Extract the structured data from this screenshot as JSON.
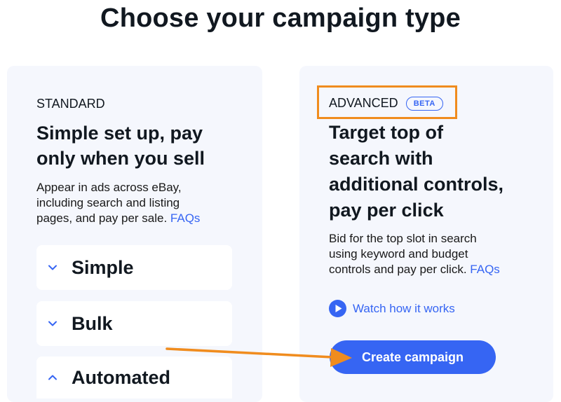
{
  "page": {
    "title": "Choose your campaign type"
  },
  "standard": {
    "kicker": "STANDARD",
    "heading_line1": "Simple set up, pay",
    "heading_line2": "only when you sell",
    "desc_line1": "Appear in ads across eBay,",
    "desc_line2": "including search and listing",
    "desc_line3": "pages, and pay per sale.",
    "faq_link": "FAQs",
    "options": [
      {
        "label": "Simple",
        "state": "collapsed",
        "icon": "chevron-down-icon"
      },
      {
        "label": "Bulk",
        "state": "collapsed",
        "icon": "chevron-down-icon"
      },
      {
        "label": "Automated",
        "state": "expanded",
        "icon": "chevron-up-icon"
      }
    ]
  },
  "advanced": {
    "kicker": "ADVANCED",
    "badge": "BETA",
    "heading_line1": "Target top of",
    "heading_line2": "search with",
    "heading_line3": "additional controls,",
    "heading_line4": "pay per click",
    "desc_line1": "Bid for the top slot in search",
    "desc_line2": "using keyword and budget",
    "desc_line3": "controls and pay per click.",
    "faq_link": "FAQs",
    "watch_link": "Watch how it works",
    "cta": "Create campaign"
  },
  "colors": {
    "accent": "#3665f3",
    "annotation": "#f08c1e",
    "card_bg": "#f5f7fd",
    "text": "#111820"
  }
}
